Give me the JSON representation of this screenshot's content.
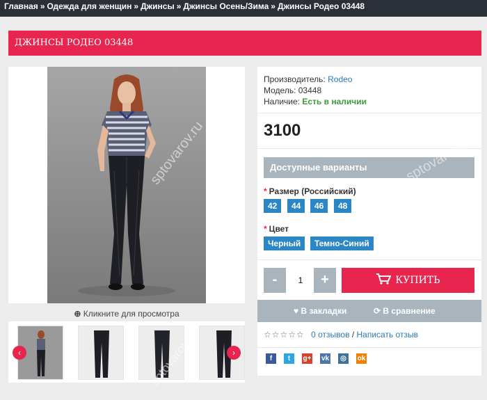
{
  "breadcrumb": {
    "items": [
      "Главная",
      "Одежда для женщин",
      "Джинсы",
      "Джинсы Осень/Зима",
      "Джинсы Родео 03448"
    ],
    "separator": "»"
  },
  "product": {
    "title": "ДЖИНСЫ РОДЕО 03448",
    "manufacturer_label": "Производитель:",
    "manufacturer": "Rodeo",
    "model_label": "Модель:",
    "model": "03448",
    "availability_label": "Наличие:",
    "availability": "Есть в наличии",
    "price": "3100"
  },
  "gallery": {
    "click_hint": "Кликните для просмотра",
    "prev_icon": "‹",
    "next_icon": "›"
  },
  "variants": {
    "heading": "Доступные варианты",
    "required_mark": "*",
    "size_label": "Размер (Российский)",
    "sizes": [
      "42",
      "44",
      "46",
      "48"
    ],
    "color_label": "Цвет",
    "colors": [
      "Черный",
      "Темно-Синий"
    ]
  },
  "cart": {
    "minus": "-",
    "quantity": "1",
    "plus": "+",
    "buy_label": "КУПИТЬ"
  },
  "actions": {
    "wishlist_label": "В закладки",
    "compare_label": "В сравнение"
  },
  "reviews": {
    "stars": "☆☆☆☆☆",
    "count_label": "0 отзывов",
    "divider": "/",
    "write_label": "Написать отзыв"
  },
  "social": {
    "facebook": "f",
    "twitter": "t",
    "googleplus": "g+",
    "vk": "vk",
    "instagram": "◎",
    "odnoklassniki": "ok"
  },
  "watermark": "sptovarov.ru",
  "colors": {
    "accent": "#e8254e",
    "chip_blue": "#2b86c6",
    "muted_bar": "#a9b4bd",
    "header_dark": "#2b3038",
    "in_stock": "#3a9b3a"
  }
}
